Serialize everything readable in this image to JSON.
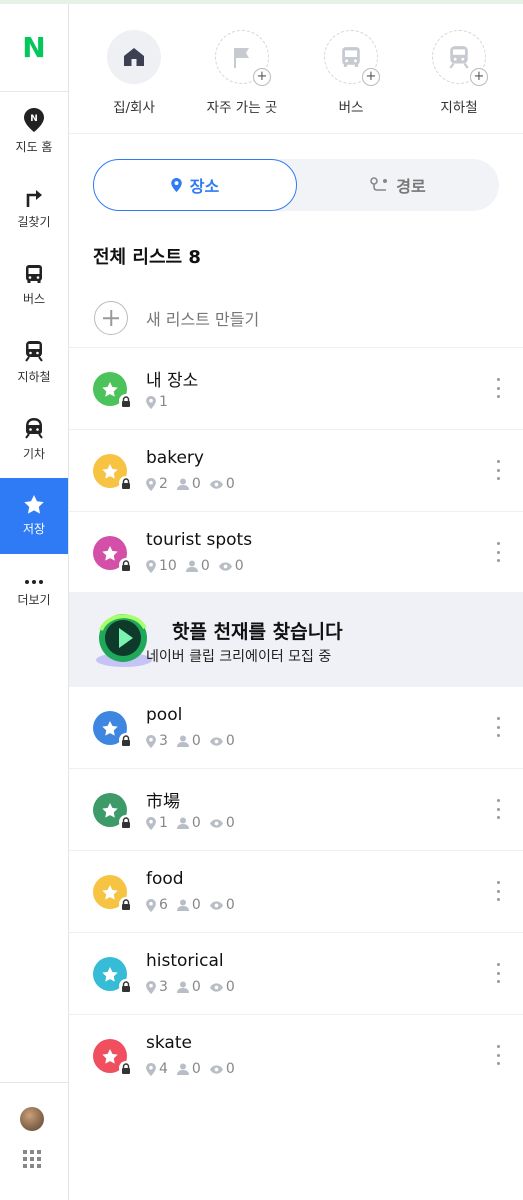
{
  "brand": {
    "logo": "N",
    "color": "#03c75a"
  },
  "nav": {
    "items": [
      {
        "label": "지도 홈",
        "icon": "map-pin-n-icon"
      },
      {
        "label": "길찾기",
        "icon": "turn-right-icon"
      },
      {
        "label": "버스",
        "icon": "bus-icon"
      },
      {
        "label": "지하철",
        "icon": "subway-icon"
      },
      {
        "label": "기차",
        "icon": "train-icon"
      },
      {
        "label": "저장",
        "icon": "star-icon",
        "active": true
      },
      {
        "label": "더보기",
        "icon": "more-dots-icon"
      }
    ]
  },
  "quick": {
    "items": [
      {
        "label": "집/회사",
        "icon": "home-icon"
      },
      {
        "label": "자주 가는 곳",
        "icon": "flag-icon"
      },
      {
        "label": "버스",
        "icon": "bus-icon"
      },
      {
        "label": "지하철",
        "icon": "subway-icon"
      }
    ]
  },
  "tabs": {
    "place": "장소",
    "route": "경로"
  },
  "list": {
    "heading": "전체 리스트 8",
    "new_list": "새 리스트 만들기",
    "rows": [
      {
        "name": "내 장소",
        "places": "1",
        "color": "#4cc25a"
      },
      {
        "name": "bakery",
        "places": "2",
        "people": "0",
        "views": "0",
        "color": "#f6c343"
      },
      {
        "name": "tourist spots",
        "places": "10",
        "people": "0",
        "views": "0",
        "color": "#d44fa8"
      },
      {
        "name": "pool",
        "places": "3",
        "people": "0",
        "views": "0",
        "color": "#3f86e0"
      },
      {
        "name": "市場",
        "places": "1",
        "people": "0",
        "views": "0",
        "color": "#3e9a68"
      },
      {
        "name": "food",
        "places": "6",
        "people": "0",
        "views": "0",
        "color": "#f6c343"
      },
      {
        "name": "historical",
        "places": "3",
        "people": "0",
        "views": "0",
        "color": "#36bcd6"
      },
      {
        "name": "skate",
        "places": "4",
        "people": "0",
        "views": "0",
        "color": "#ef4f5f"
      }
    ]
  },
  "banner": {
    "title": "핫플 천재를 찾습니다",
    "subtitle": "네이버 클립 크리에이터 모집 중"
  },
  "accent": "#2f7bf5"
}
